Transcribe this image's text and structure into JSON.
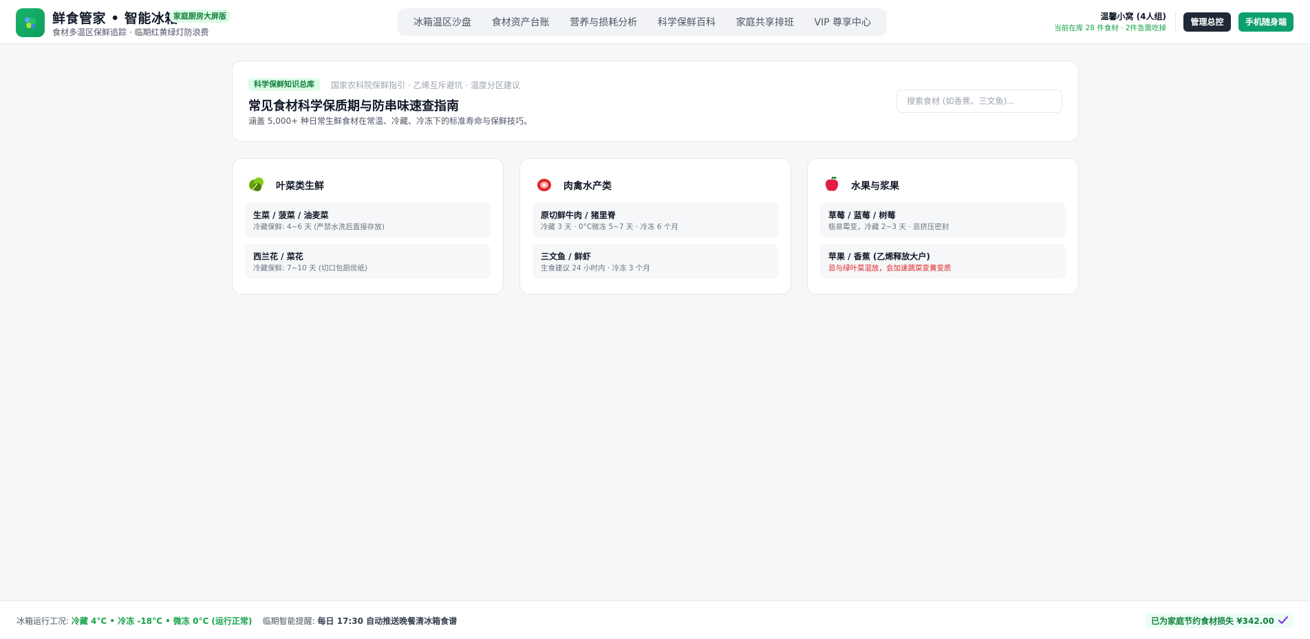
{
  "header": {
    "brand_title": "鲜食管家 • 智能冰箱",
    "brand_badge": "家庭厨房大屏版",
    "brand_subtitle": "食材多温区保鲜追踪 · 临期红黄绿灯防浪费",
    "nav": [
      {
        "label": "冰箱温区沙盘"
      },
      {
        "label": "食材资产台账"
      },
      {
        "label": "营养与损耗分析"
      },
      {
        "label": "科学保鲜百科"
      },
      {
        "label": "家庭共享排班"
      },
      {
        "label": "VIP 尊享中心"
      }
    ],
    "user_name": "温馨小窝 (4人组)",
    "user_stat": "当前在库 28 件食材 · 2件急需吃掉",
    "admin_button": "管理总控",
    "mobile_button": "手机随身端"
  },
  "hero": {
    "tag": "科学保鲜知识总库",
    "source": "国家农科院保鲜指引 · 乙烯互斥避坑 · 温度分区建议",
    "title": "常见食材科学保质期与防串味速查指南",
    "description": "涵盖 5,000+ 种日常生鲜食材在常温、冷藏、冷冻下的标准寿命与保鲜技巧。",
    "search_placeholder": "搜索食材 (如香蕉、三文鱼)..."
  },
  "categories": [
    {
      "icon": "leafy-greens-icon",
      "title": "叶菜类生鲜",
      "items": [
        {
          "name": "生菜 / 菠菜 / 油麦菜",
          "note": "冷藏保鲜: 4~6 天 (严禁水洗后直接存放)"
        },
        {
          "name": "西兰花 / 菜花",
          "note": "冷藏保鲜: 7~10 天 (切口包厨房纸)"
        }
      ]
    },
    {
      "icon": "meat-icon",
      "title": "肉禽水产类",
      "items": [
        {
          "name": "原切鲜牛肉 / 猪里脊",
          "note": "冷藏 3 天 · 0°C微冻 5~7 天 · 冷冻 6 个月"
        },
        {
          "name": "三文鱼 / 鲜虾",
          "note": "生食建议 24 小时内 · 冷冻 3 个月"
        }
      ]
    },
    {
      "icon": "apple-icon",
      "title": "水果与浆果",
      "items": [
        {
          "name": "草莓 / 蓝莓 / 树莓",
          "note": "极易霉变，冷藏 2~3 天 · 忌挤压密封"
        },
        {
          "name": "苹果 / 香蕉 (乙烯释放大户)",
          "note": "忌与绿叶菜混放，会加速蔬菜变黄变质",
          "warning": true
        }
      ]
    }
  ],
  "footer": {
    "status_label": "冰箱运行工况:",
    "status_value": "冷藏 4°C • 冷冻 -18°C • 微冻 0°C (运行正常)",
    "reminder_label": "临期智能提醒:",
    "reminder_value": "每日 17:30 自动推送晚餐清冰箱食谱",
    "savings": "已为家庭节约食材损失 ¥342.00"
  },
  "colors": {
    "brand_green": "#0e9f6e",
    "dark_button": "#1f2937",
    "warning_red": "#dc2626",
    "badge_bg": "#dcfce7"
  }
}
